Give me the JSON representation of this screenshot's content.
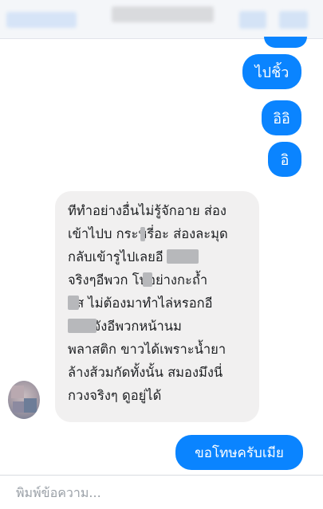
{
  "header": {
    "contact_name": "",
    "note": ""
  },
  "messages": [
    {
      "from": "me",
      "text": "ไปชิ้ว"
    },
    {
      "from": "me",
      "text": "อิอิ"
    },
    {
      "from": "me",
      "text": "อิ"
    },
    {
      "from": "other",
      "lines": [
        "ทีทำอย่างอื่นไม่รู้จักอาย ส่อง",
        "เข้าไปบ กระหรี่อะ ส่องละมุด",
        "กลับเข้ารูไปเลยอี        ชอบ",
        "จริงๆอีพวก   โบ๋อย่างกะถ้ำ",
        "    ลัส ไม่ต้องมาทำไล่หรอกอี",
        "          ชอบจังอีพวกหน้านม",
        "พลาสติก ขาวได้เพราะน้ำยา",
        "ล้างส้วมกัดทั้งนั้น สมองมึงนี่",
        "กวงจริงๆ ดูอยู่ได้"
      ]
    },
    {
      "from": "me",
      "text": "ขอโทษครับเมีย"
    }
  ],
  "composer": {
    "placeholder": "พิมพ์ข้อความ..."
  },
  "colors": {
    "outgoing": "#0a84ff",
    "incoming": "#f1f0f0"
  }
}
